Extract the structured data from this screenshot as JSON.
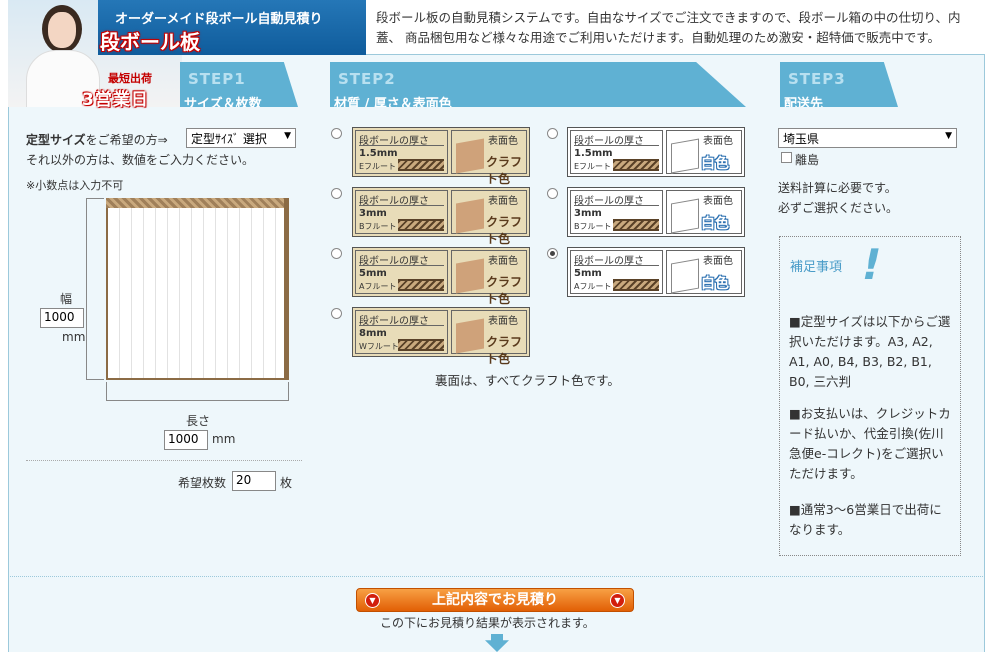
{
  "header": {
    "title_sub": "オーダーメイド段ボール自動見積り",
    "title_main": "段ボール板",
    "badge_small": "最短出荷",
    "badge_big": "3営業日",
    "intro": "段ボール板の自動見積システムです。自由なサイズでご注文できますので、段ボール箱の中の仕切り、内蓋、 商品梱包用など様々な用途でご利用いただけます。自動処理のため激安・超特価で販売中です。"
  },
  "steps": [
    {
      "num": "STEP1",
      "title": "サイズ＆枚数"
    },
    {
      "num": "STEP2",
      "title": "材質 / 厚さ＆表面色"
    },
    {
      "num": "STEP3",
      "title": "配送先"
    }
  ],
  "step1": {
    "label_bold": "定型サイズ",
    "label_rest": "をご希望の方⇒",
    "size_select": "定型ｻｲｽﾞ 選択",
    "other_text": "それ以外の方は、数値をご入力ください。",
    "decimal_note": "※小数点は入力不可",
    "width_label": "幅",
    "width_value": "1000",
    "width_unit": "mm",
    "length_label": "長さ",
    "length_value": "1000",
    "length_unit": "mm",
    "qty_label": "希望枚数",
    "qty_value": "20",
    "qty_unit": "枚"
  },
  "step2": {
    "thickness_header": "段ボールの厚さ",
    "color_header": "表面色",
    "options": [
      {
        "mm": "1.5mm",
        "flute": "Eフルート",
        "color": "クラフト色",
        "white": false,
        "selected": false
      },
      {
        "mm": "1.5mm",
        "flute": "Eフルート",
        "color": "白色",
        "white": true,
        "selected": false
      },
      {
        "mm": "3mm",
        "flute": "Bフルート",
        "color": "クラフト色",
        "white": false,
        "selected": false
      },
      {
        "mm": "3mm",
        "flute": "Bフルート",
        "color": "白色",
        "white": true,
        "selected": false
      },
      {
        "mm": "5mm",
        "flute": "Aフルート",
        "color": "クラフト色",
        "white": false,
        "selected": false
      },
      {
        "mm": "5mm",
        "flute": "Aフルート",
        "color": "白色",
        "white": true,
        "selected": true
      },
      {
        "mm": "8mm",
        "flute": "Wフルート",
        "color": "クラフト色",
        "white": false,
        "selected": false
      }
    ],
    "back_note": "裏面は、すべてクラフト色です。"
  },
  "step3": {
    "pref_select": "埼玉県",
    "island_label": "離島",
    "shipping_note_1": "送料計算に必要です。",
    "shipping_note_2": "必ずご選択ください。"
  },
  "notes": {
    "title": "補足事項",
    "items": [
      "■定型サイズは以下からご選択いただけます。A3, A2, A1, A0, B4, B3, B2, B1, B0, 三六判",
      "■お支払いは、クレジットカード払いか、代金引換(佐川急便e-コレクト)をご選択いただけます。",
      "■通常3～6営業日で出荷になります。"
    ]
  },
  "submit": {
    "label": "上記内容でお見積り",
    "note": "この下にお見積り結果が表示されます。"
  },
  "colors": {
    "accent": "#5fb1d3",
    "header_blue": "#1a6aa8",
    "button_orange": "#f08020",
    "kraft": "#e8dcb8"
  }
}
